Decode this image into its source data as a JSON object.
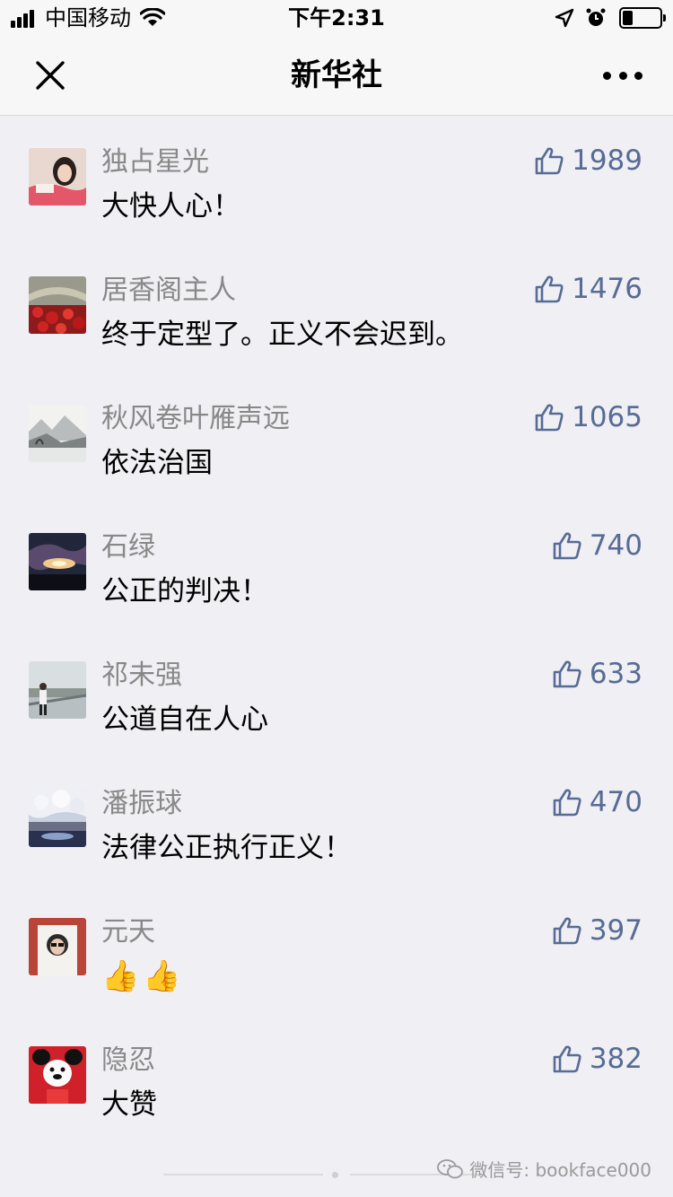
{
  "status_bar": {
    "carrier": "中国移动",
    "time": "下午2:31",
    "battery_level": 0.3,
    "icons": [
      "signal-icon",
      "wifi-icon",
      "location-icon",
      "alarm-icon",
      "battery-icon"
    ]
  },
  "nav": {
    "title": "新华社",
    "close_icon": "close-icon",
    "more_icon": "more-icon"
  },
  "comments": [
    {
      "nick": "独占星光",
      "text": "大快人心！",
      "likes": "1989"
    },
    {
      "nick": "居香阁主人",
      "text": "终于定型了。正义不会迟到。",
      "likes": "1476"
    },
    {
      "nick": "秋风卷叶雁声远",
      "text": "依法治国",
      "likes": "1065"
    },
    {
      "nick": "石绿",
      "text": "公正的判决！",
      "likes": "740"
    },
    {
      "nick": "祁未强",
      "text": "公道自在人心",
      "likes": "633"
    },
    {
      "nick": "潘振球",
      "text": "法律公正执行正义！",
      "likes": "470"
    },
    {
      "nick": "元天",
      "text": "👍👍",
      "likes": "397"
    },
    {
      "nick": "隐忍",
      "text": "大赞",
      "likes": "382"
    }
  ],
  "watermark": "微信号: bookface000",
  "colors": {
    "like": "#576b95",
    "nickname": "#888888",
    "background": "#efeff4"
  }
}
